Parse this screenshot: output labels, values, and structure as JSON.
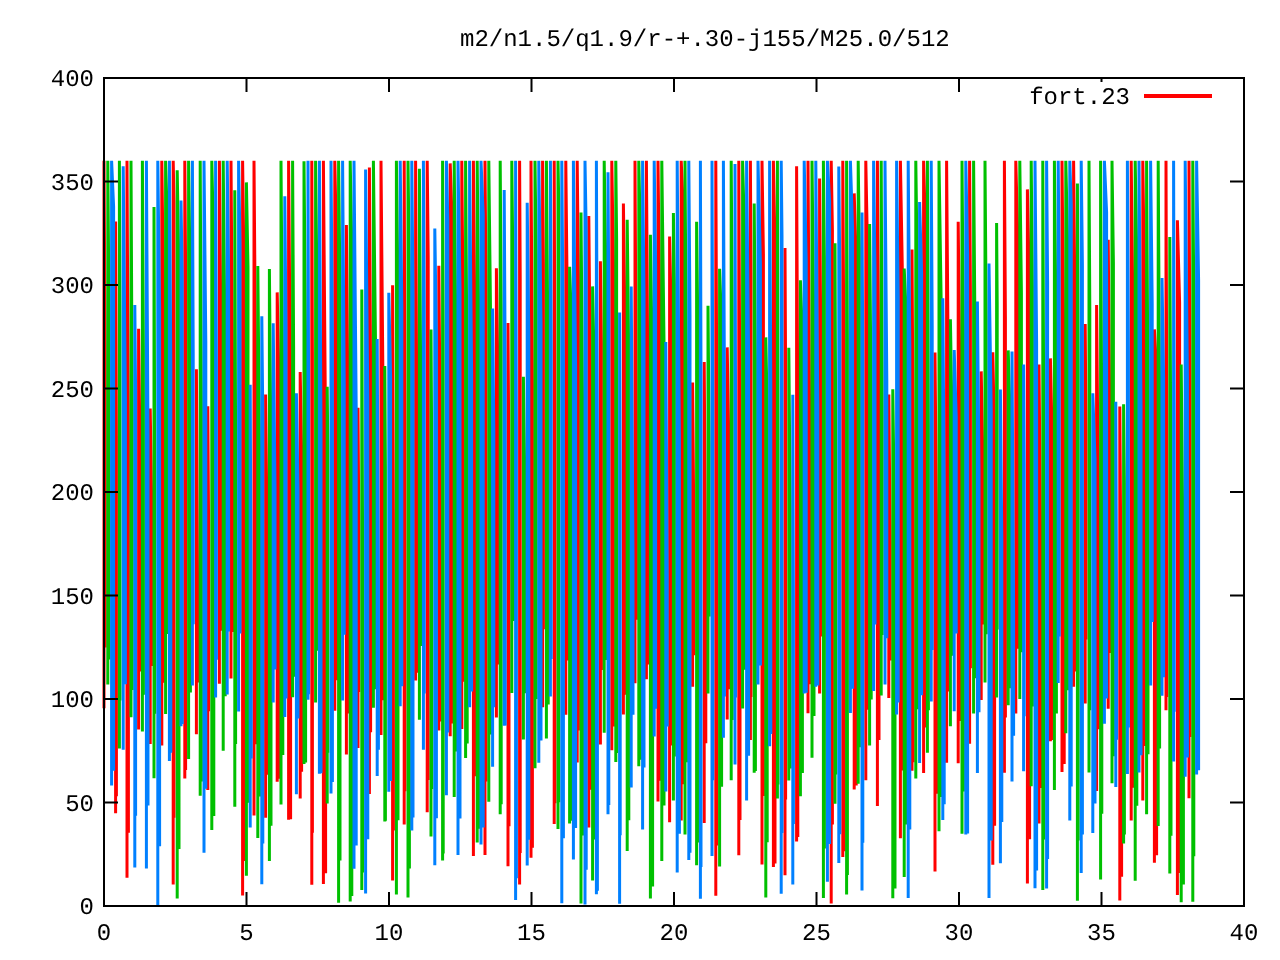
{
  "title": "m2/n1.5/q1.9/r-+.30-j155/M25.0/512",
  "legend": {
    "label": "fort.23",
    "color": "#ff0000"
  },
  "x_axis": {
    "ticks": [
      "0",
      "5",
      "10",
      "15",
      "20",
      "25",
      "30",
      "35",
      "40"
    ]
  },
  "y_axis": {
    "ticks": [
      "400",
      "350",
      "300",
      "250",
      "200",
      "150",
      "100",
      "50",
      "0"
    ]
  },
  "traces": [
    {
      "color": "#ff0000"
    },
    {
      "color": "#00c000"
    },
    {
      "color": "#0080ff"
    }
  ]
}
